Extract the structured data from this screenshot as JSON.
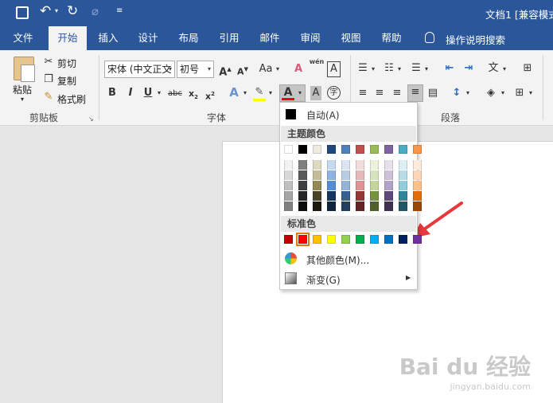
{
  "titlebar": {
    "doc_title": "文档1 [兼容模式",
    "colors": {
      "accent": "#2b579a"
    }
  },
  "tabs": [
    {
      "label": "文件"
    },
    {
      "label": "开始"
    },
    {
      "label": "插入"
    },
    {
      "label": "设计"
    },
    {
      "label": "布局"
    },
    {
      "label": "引用"
    },
    {
      "label": "邮件"
    },
    {
      "label": "审阅"
    },
    {
      "label": "视图"
    },
    {
      "label": "帮助"
    }
  ],
  "tell_me": "操作说明搜索",
  "clipboard": {
    "paste": "粘贴",
    "cut": "剪切",
    "copy": "复制",
    "format_painter": "格式刷",
    "group": "剪贴板"
  },
  "font": {
    "family": "宋体 (中文正文",
    "size": "初号",
    "group": "字体",
    "aa_label": "Aa",
    "wen": "wén",
    "a_letter": "A"
  },
  "paragraph": {
    "group": "段落"
  },
  "color_menu": {
    "auto": "自动(A)",
    "theme_header": "主题颜色",
    "standard_header": "标准色",
    "more_colors": "其他颜色(M)...",
    "gradient": "渐变(G)",
    "theme_top": [
      "#ffffff",
      "#000000",
      "#eeece1",
      "#1f497d",
      "#4f81bd",
      "#c0504d",
      "#9bbb59",
      "#8064a2",
      "#4bacc6",
      "#f79646"
    ],
    "theme_shades": [
      [
        "#f2f2f2",
        "#d8d8d8",
        "#bfbfbf",
        "#a5a5a5",
        "#7f7f7f"
      ],
      [
        "#7f7f7f",
        "#595959",
        "#3f3f3f",
        "#262626",
        "#0c0c0c"
      ],
      [
        "#ddd9c3",
        "#c4bd97",
        "#938953",
        "#494429",
        "#1d1b10"
      ],
      [
        "#c6d9f0",
        "#8db3e2",
        "#548dd4",
        "#17365d",
        "#0f243e"
      ],
      [
        "#dbe5f1",
        "#b8cce4",
        "#95b3d7",
        "#366092",
        "#244061"
      ],
      [
        "#f2dcdb",
        "#e5b9b7",
        "#d99694",
        "#953734",
        "#632423"
      ],
      [
        "#ebf1dd",
        "#d7e3bc",
        "#c3d69b",
        "#76923c",
        "#4f6128"
      ],
      [
        "#e5e0ec",
        "#ccc1d9",
        "#b2a2c7",
        "#5f497a",
        "#3f3151"
      ],
      [
        "#dbeef3",
        "#b7dde8",
        "#92cddc",
        "#31859b",
        "#205867"
      ],
      [
        "#fdeada",
        "#fbd5b5",
        "#fac08f",
        "#e36c09",
        "#974806"
      ]
    ],
    "standard": [
      "#c00000",
      "#ff0000",
      "#ffc000",
      "#ffff00",
      "#92d050",
      "#00b050",
      "#00b0f0",
      "#0070c0",
      "#002060",
      "#7030a0"
    ]
  },
  "watermark": {
    "brand": "Bai du 经验",
    "url": "jingyan.baidu.com"
  }
}
